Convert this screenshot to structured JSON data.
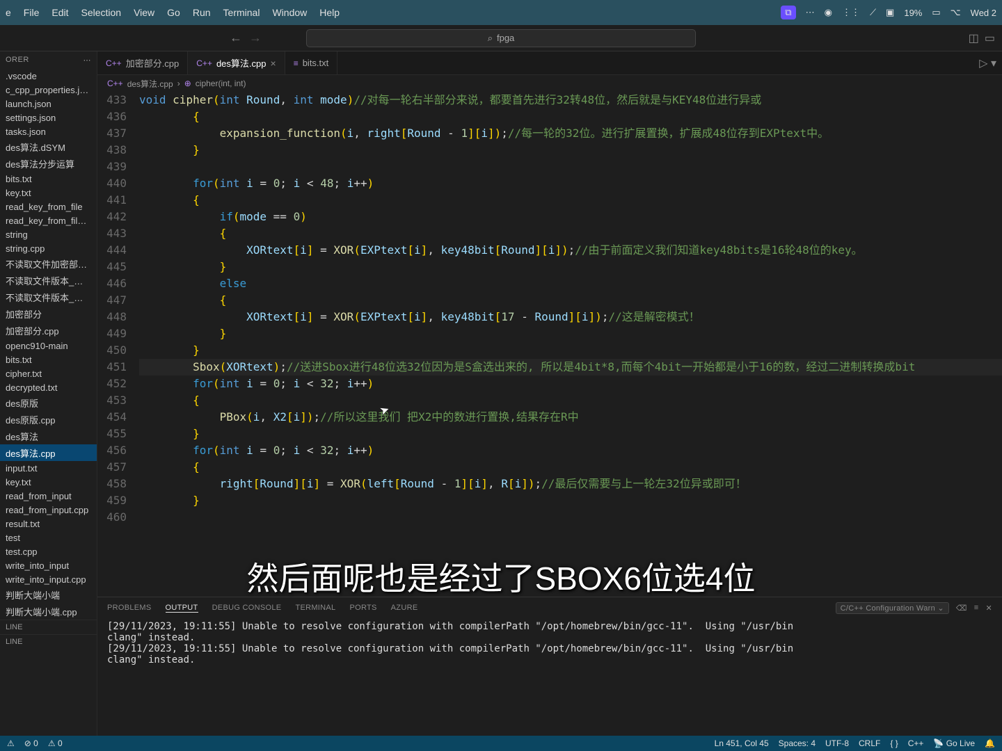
{
  "menubar": {
    "items": [
      "e",
      "File",
      "Edit",
      "Selection",
      "View",
      "Go",
      "Run",
      "Terminal",
      "Window",
      "Help"
    ],
    "right": {
      "battery": "19%",
      "date": "Wed 2"
    }
  },
  "search": {
    "text": "fpga"
  },
  "sidebar": {
    "header": "ORER",
    "files": [
      ".vscode",
      "c_cpp_properties.json",
      "launch.json",
      "settings.json",
      "tasks.json",
      "des算法.dSYM",
      "des算法分步运算",
      "bits.txt",
      "key.txt",
      "read_key_from_file",
      "read_key_from_file.cpp",
      "string",
      "string.cpp",
      "不读取文件加密部分…",
      "不读取文件版本_无调试",
      "不读取文件版本_无调…",
      "加密部分",
      "加密部分.cpp",
      "openc910-main",
      "bits.txt",
      "cipher.txt",
      "decrypted.txt",
      "des原版",
      "des原版.cpp",
      "des算法",
      "des算法.cpp",
      "input.txt",
      "key.txt",
      "read_from_input",
      "read_from_input.cpp",
      "result.txt",
      "test",
      "test.cpp",
      "write_into_input",
      "write_into_input.cpp",
      "判断大端小端",
      "判断大端小端.cpp"
    ],
    "selected_index": 25,
    "outline1": "LINE",
    "outline2": "LINE"
  },
  "tabs": [
    {
      "icon": "C++",
      "label": "加密部分.cpp",
      "active": false
    },
    {
      "icon": "C++",
      "label": "des算法.cpp",
      "active": true
    },
    {
      "icon": "≡",
      "label": "bits.txt",
      "active": false
    }
  ],
  "breadcrumb": {
    "file": "des算法.cpp",
    "symbol": "cipher(int, int)"
  },
  "code": {
    "start": 433,
    "lines": [
      {
        "n": 433,
        "html": "<span class='type'>void</span> <span class='fn'>cipher</span><span class='paren'>(</span><span class='type'>int</span> <span class='ident'>Round</span><span class='op'>,</span> <span class='type'>int</span> <span class='ident'>mode</span><span class='paren'>)</span><span class='comment'>//对每一轮右半部分来说，都要首先进行32转48位，然后就是与KEY48位进行异或</span>"
      },
      {
        "n": 436,
        "html": "        <span class='paren'>{</span>"
      },
      {
        "n": 437,
        "html": "            <span class='fn'>expansion_function</span><span class='paren'>(</span><span class='ident'>i</span><span class='op'>,</span> <span class='ident'>right</span><span class='paren'>[</span><span class='ident'>Round</span> <span class='op'>-</span> <span class='num'>1</span><span class='paren'>][</span><span class='ident'>i</span><span class='paren'>])</span><span class='op'>;</span><span class='comment'>//每一轮的32位。进行扩展置换，扩展成48位存到EXPtext中。</span>"
      },
      {
        "n": 438,
        "html": "        <span class='paren'>}</span>"
      },
      {
        "n": 439,
        "html": ""
      },
      {
        "n": 440,
        "html": "        <span class='kw'>for</span><span class='paren'>(</span><span class='type'>int</span> <span class='ident'>i</span> <span class='op'>=</span> <span class='num'>0</span><span class='op'>;</span> <span class='ident'>i</span> <span class='op'>&lt;</span> <span class='num'>48</span><span class='op'>;</span> <span class='ident'>i</span><span class='op'>++</span><span class='paren'>)</span>"
      },
      {
        "n": 441,
        "html": "        <span class='paren'>{</span>"
      },
      {
        "n": 442,
        "html": "            <span class='kw'>if</span><span class='paren'>(</span><span class='ident'>mode</span> <span class='op'>==</span> <span class='num'>0</span><span class='paren'>)</span>"
      },
      {
        "n": 443,
        "html": "            <span class='paren'>{</span>"
      },
      {
        "n": 444,
        "html": "                <span class='ident'>XORtext</span><span class='paren'>[</span><span class='ident'>i</span><span class='paren'>]</span> <span class='op'>=</span> <span class='fn'>XOR</span><span class='paren'>(</span><span class='ident'>EXPtext</span><span class='paren'>[</span><span class='ident'>i</span><span class='paren'>]</span><span class='op'>,</span> <span class='ident'>key48bit</span><span class='paren'>[</span><span class='ident'>Round</span><span class='paren'>][</span><span class='ident'>i</span><span class='paren'>])</span><span class='op'>;</span><span class='comment'>//由于前面定义我们知道key48bits是16轮48位的key。</span>"
      },
      {
        "n": 445,
        "html": "            <span class='paren'>}</span>"
      },
      {
        "n": 446,
        "html": "            <span class='kw'>else</span>"
      },
      {
        "n": 447,
        "html": "            <span class='paren'>{</span>"
      },
      {
        "n": 448,
        "html": "                <span class='ident'>XORtext</span><span class='paren'>[</span><span class='ident'>i</span><span class='paren'>]</span> <span class='op'>=</span> <span class='fn'>XOR</span><span class='paren'>(</span><span class='ident'>EXPtext</span><span class='paren'>[</span><span class='ident'>i</span><span class='paren'>]</span><span class='op'>,</span> <span class='ident'>key48bit</span><span class='paren'>[</span><span class='num'>17</span> <span class='op'>-</span> <span class='ident'>Round</span><span class='paren'>][</span><span class='ident'>i</span><span class='paren'>])</span><span class='op'>;</span><span class='comment'>//这是解密模式！</span>"
      },
      {
        "n": 449,
        "html": "            <span class='paren'>}</span>"
      },
      {
        "n": 450,
        "html": "        <span class='paren'>}</span>"
      },
      {
        "n": 451,
        "html": "        <span class='fn'>Sbox</span><span class='paren'>(</span><span class='ident'>XORtext</span><span class='paren'>)</span><span class='op'>;</span><span class='comment'>//送进Sbox进行48位选32位因为是S盒选出来的,</span> <span class='comment'>所以是4bit*8,而每个4bit一开始都是小于16的数，经过二进制转换成bit</span>",
        "hl": true
      },
      {
        "n": 452,
        "html": "        <span class='kw'>for</span><span class='paren'>(</span><span class='type'>int</span> <span class='ident'>i</span> <span class='op'>=</span> <span class='num'>0</span><span class='op'>;</span> <span class='ident'>i</span> <span class='op'>&lt;</span> <span class='num'>32</span><span class='op'>;</span> <span class='ident'>i</span><span class='op'>++</span><span class='paren'>)</span>"
      },
      {
        "n": 453,
        "html": "        <span class='paren'>{</span>"
      },
      {
        "n": 454,
        "html": "            <span class='fn'>PBox</span><span class='paren'>(</span><span class='ident'>i</span><span class='op'>,</span> <span class='ident'>X2</span><span class='paren'>[</span><span class='ident'>i</span><span class='paren'>])</span><span class='op'>;</span><span class='comment'>//所以这里我们 把X2中的数进行置换,结果存在R中</span>"
      },
      {
        "n": 455,
        "html": "        <span class='paren'>}</span>"
      },
      {
        "n": 456,
        "html": "        <span class='kw'>for</span><span class='paren'>(</span><span class='type'>int</span> <span class='ident'>i</span> <span class='op'>=</span> <span class='num'>0</span><span class='op'>;</span> <span class='ident'>i</span> <span class='op'>&lt;</span> <span class='num'>32</span><span class='op'>;</span> <span class='ident'>i</span><span class='op'>++</span><span class='paren'>)</span>"
      },
      {
        "n": 457,
        "html": "        <span class='paren'>{</span>"
      },
      {
        "n": 458,
        "html": "            <span class='ident'>right</span><span class='paren'>[</span><span class='ident'>Round</span><span class='paren'>][</span><span class='ident'>i</span><span class='paren'>]</span> <span class='op'>=</span> <span class='fn'>XOR</span><span class='paren'>(</span><span class='ident'>left</span><span class='paren'>[</span><span class='ident'>Round</span> <span class='op'>-</span> <span class='num'>1</span><span class='paren'>][</span><span class='ident'>i</span><span class='paren'>]</span><span class='op'>,</span> <span class='ident'>R</span><span class='paren'>[</span><span class='ident'>i</span><span class='paren'>])</span><span class='op'>;</span><span class='comment'>//最后仅需要与上一轮左32位异或即可！</span>"
      },
      {
        "n": 459,
        "html": "        <span class='paren'>}</span>"
      },
      {
        "n": 460,
        "html": ""
      }
    ]
  },
  "panel": {
    "tabs": [
      "PROBLEMS",
      "OUTPUT",
      "DEBUG CONSOLE",
      "TERMINAL",
      "PORTS",
      "AZURE"
    ],
    "active": 1,
    "config": "C/C++ Configuration Warn",
    "output": "[29/11/2023, 19:11:55] Unable to resolve configuration with compilerPath \"/opt/homebrew/bin/gcc-11\".  Using \"/usr/bin\nclang\" instead.\n[29/11/2023, 19:11:55] Unable to resolve configuration with compilerPath \"/opt/homebrew/bin/gcc-11\".  Using \"/usr/bin\nclang\" instead."
  },
  "statusbar": {
    "left": {
      "errors": "0",
      "warnings": "0"
    },
    "right": {
      "pos": "Ln 451, Col 45",
      "spaces": "Spaces: 4",
      "enc": "UTF-8",
      "eol": "CRLF",
      "lang": "C++",
      "golive": "Go Live"
    }
  },
  "subtitle": "然后面呢也是经过了SBOX6位选4位"
}
